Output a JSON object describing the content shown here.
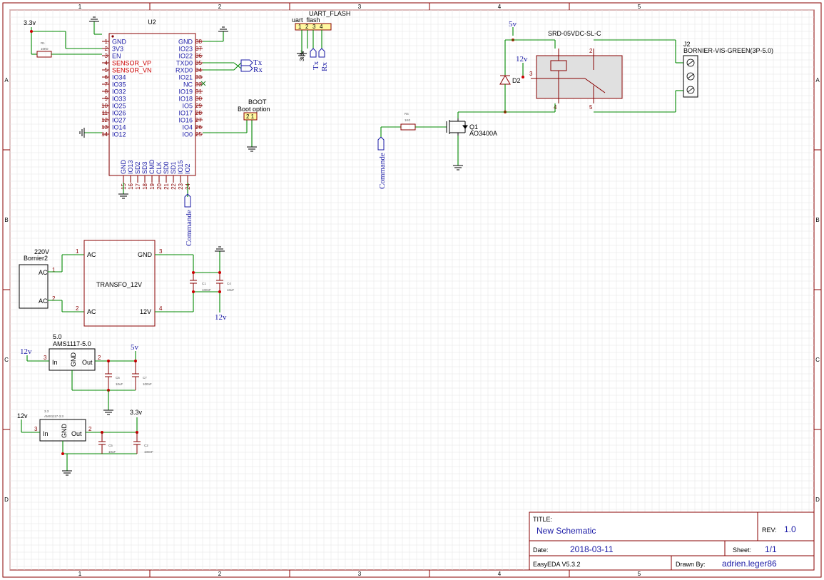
{
  "frame": {
    "columns": [
      "1",
      "2",
      "3",
      "4",
      "5"
    ],
    "rows": [
      "A",
      "B",
      "C",
      "D"
    ]
  },
  "title_block": {
    "title_label": "TITLE:",
    "title": "New Schematic",
    "rev_label": "REV:",
    "rev": "1.0",
    "date_label": "Date:",
    "date": "2018-03-11",
    "sheet_label": "Sheet:",
    "sheet": "1/1",
    "tool": "EasyEDA V5.3.2",
    "drawn_label": "Drawn By:",
    "drawn_by": "adrien.leger86"
  },
  "u2": {
    "ref": "U2",
    "left_pins": [
      {
        "num": "1",
        "name": "GND"
      },
      {
        "num": "2",
        "name": "3V3"
      },
      {
        "num": "3",
        "name": "EN"
      },
      {
        "num": "4",
        "name": "SENSOR_VP"
      },
      {
        "num": "5",
        "name": "SENSOR_VN"
      },
      {
        "num": "6",
        "name": "IO34"
      },
      {
        "num": "7",
        "name": "IO35"
      },
      {
        "num": "8",
        "name": "IO32"
      },
      {
        "num": "9",
        "name": "IO33"
      },
      {
        "num": "10",
        "name": "IO25"
      },
      {
        "num": "11",
        "name": "IO26"
      },
      {
        "num": "12",
        "name": "IO27"
      },
      {
        "num": "13",
        "name": "IO14"
      },
      {
        "num": "14",
        "name": "IO12"
      }
    ],
    "right_pins": [
      {
        "num": "38",
        "name": "GND"
      },
      {
        "num": "37",
        "name": "IO23"
      },
      {
        "num": "36",
        "name": "IO22"
      },
      {
        "num": "35",
        "name": "TXD0"
      },
      {
        "num": "34",
        "name": "RXD0"
      },
      {
        "num": "33",
        "name": "IO21"
      },
      {
        "num": "32",
        "name": "NC"
      },
      {
        "num": "31",
        "name": "IO19"
      },
      {
        "num": "30",
        "name": "IO18"
      },
      {
        "num": "29",
        "name": "IO5"
      },
      {
        "num": "28",
        "name": "IO17"
      },
      {
        "num": "27",
        "name": "IO16"
      },
      {
        "num": "26",
        "name": "IO4"
      },
      {
        "num": "25",
        "name": "IO0"
      }
    ],
    "bottom_pins": [
      {
        "num": "15",
        "name": "GND"
      },
      {
        "num": "16",
        "name": "IO13"
      },
      {
        "num": "17",
        "name": "SD2"
      },
      {
        "num": "18",
        "name": "SD3"
      },
      {
        "num": "19",
        "name": "CMD"
      },
      {
        "num": "20",
        "name": "CLK"
      },
      {
        "num": "21",
        "name": "SD0"
      },
      {
        "num": "22",
        "name": "SD1"
      },
      {
        "num": "23",
        "name": "IO15"
      },
      {
        "num": "24",
        "name": "IO2"
      }
    ]
  },
  "labels": {
    "v33": "3.3v",
    "v33b": "3.3v",
    "r1_ref": "R1",
    "r1_val": "10K0",
    "tx": "Tx",
    "rx": "Rx",
    "boot_title": "BOOT",
    "boot_option": "Boot option",
    "boot_pins": "2 1",
    "uart_title": "UART_FLASH",
    "uart_name": "uart_flash",
    "uart_pins": [
      "1",
      "2",
      "3",
      "4"
    ],
    "uart_33v": "3.3v",
    "uart_tx": "Tx",
    "uart_rx": "Rx",
    "commande_u2": "Commande",
    "commande_q1": "Commande",
    "v5_relay": "5v",
    "relay_name": "SRD-05VDC-SL-C",
    "relay_pins": [
      "1",
      "2",
      "3",
      "4",
      "5"
    ],
    "v12_relay": "12v",
    "d2": "D2",
    "r4_ref": "R4",
    "r4_val": "1K0",
    "q1_ref": "Q1",
    "q1_val": "AO3400A",
    "j2_ref": "J2",
    "j2_name": "BORNIER-VIS-GREEN(3P-5.0)",
    "bornier_v": "220V",
    "bornier_ref": "Bornier2",
    "bornier_ac1": "AC",
    "bornier_ac2": "AC",
    "bornier_p1": "1",
    "bornier_p2": "2",
    "transfo_name": "TRANSFO_12V",
    "tr_ac1": "AC",
    "tr_ac2": "AC",
    "tr_gnd": "GND",
    "tr_12v": "12V",
    "tr_p1": "1",
    "tr_p2": "2",
    "tr_p3": "3",
    "tr_p4": "4",
    "c1_ref": "C1",
    "c1_val": "100nF",
    "c4_ref": "C4",
    "c4_val": "10uF",
    "v12_tr": "12v",
    "reg5_val": "5.0",
    "reg5_name": "AMS1117-5.0",
    "reg_in": "In",
    "reg_out": "Out",
    "reg_gnd": "GND",
    "v12_reg5": "12v",
    "v5_reg5": "5v",
    "reg5_p3": "3",
    "reg5_p2": "2",
    "reg5_p1": "1",
    "c6_ref": "C6",
    "c6_val": "10uF",
    "c7_ref": "C7",
    "c7_val": "100nF",
    "reg33_val": "3.3",
    "reg33_name": "AMS1117-3.3",
    "v12_reg33": "12v",
    "reg33_p3": "3",
    "reg33_p2": "2",
    "reg33_p1": "1",
    "c5_ref": "C5",
    "c5_val": "10uF",
    "c2_ref": "C2",
    "c2_val": "100nF"
  }
}
